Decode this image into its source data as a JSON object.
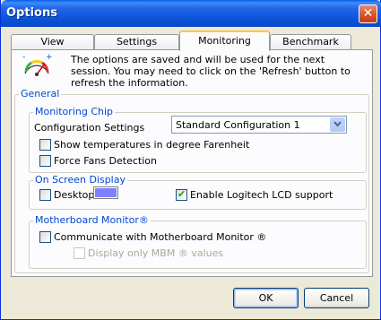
{
  "window": {
    "title": "Options",
    "close_glyph": "✕"
  },
  "tabs": [
    {
      "label": "View",
      "active": false
    },
    {
      "label": "Settings",
      "active": false
    },
    {
      "label": "Monitoring",
      "active": true
    },
    {
      "label": "Benchmark",
      "active": false
    }
  ],
  "info": {
    "icon": "gauge-icon",
    "text": "The options are saved and will be used for the next session. You may need to click on the 'Refresh' button to refresh the information."
  },
  "general": {
    "title": "General",
    "monitoring_chip": {
      "title": "Monitoring Chip",
      "config_label": "Configuration Settings",
      "config_value": "Standard Configuration 1",
      "fahrenheit_label": "Show temperatures in degree Farenheit",
      "fahrenheit_checked": false,
      "force_fans_label": "Force Fans Detection",
      "force_fans_checked": false
    },
    "osd": {
      "title": "On Screen Display",
      "desktop_label": "Desktop",
      "desktop_checked": false,
      "desktop_color": "#8080ff",
      "logitech_label": "Enable Logitech LCD support",
      "logitech_checked": true
    },
    "mbm": {
      "title": "Motherboard Monitor®",
      "communicate_label": "Communicate with Motherboard Monitor  ®",
      "communicate_checked": false,
      "display_only_label": "Display only MBM ® values",
      "display_only_checked": false,
      "display_only_enabled": false
    }
  },
  "buttons": {
    "ok": "OK",
    "cancel": "Cancel"
  },
  "colors": {
    "group_title": "#0046d5",
    "titlebar": "#0a5ce6",
    "check": "#21a121"
  }
}
